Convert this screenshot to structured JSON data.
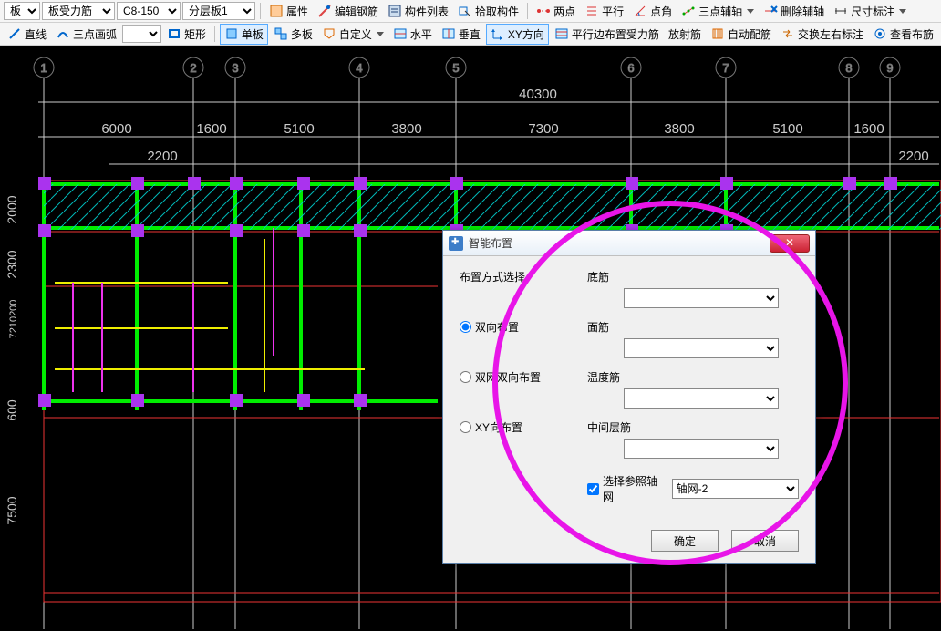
{
  "toolbar1": {
    "sel_layer": "板",
    "sel_rebar_type": "板受力筋",
    "sel_spec": "C8-150",
    "sel_group": "分层板1",
    "btn_props": "属性",
    "btn_edit_rebar": "编辑钢筋",
    "btn_elem_list": "构件列表",
    "btn_pick_elem": "拾取构件",
    "btn_two_pt": "两点",
    "btn_parallel": "平行",
    "btn_pt_angle": "点角",
    "btn_three_pt_aux": "三点辅轴",
    "btn_del_aux": "删除辅轴",
    "btn_dim": "尺寸标注"
  },
  "toolbar2": {
    "btn_line": "直线",
    "btn_arc3": "三点画弧",
    "color_box": "",
    "btn_rect": "矩形",
    "btn_single": "单板",
    "btn_multi": "多板",
    "btn_custom": "自定义",
    "btn_horiz": "水平",
    "btn_vert": "垂直",
    "btn_xy": "XY方向",
    "btn_par_edge": "平行边布置受力筋",
    "btn_radial": "放射筋",
    "btn_auto": "自动配筋",
    "btn_swap_lr": "交换左右标注",
    "btn_view_arr": "查看布筋"
  },
  "canvas_labels": {
    "top_total": "40300",
    "spans_top": [
      "6000",
      "1600",
      "5100",
      "3800",
      "7300",
      "3800",
      "5100",
      "1600"
    ],
    "sub1": "2200",
    "sub2": "2200",
    "left": [
      "2000",
      "2300",
      "7210200",
      "600",
      "7500"
    ],
    "grid_top": [
      "1",
      "2",
      "3",
      "4",
      "5",
      "6",
      "7",
      "8",
      "9"
    ]
  },
  "dialog": {
    "title": "智能布置",
    "section_title": "布置方式选择",
    "radio1": "双向布置",
    "radio2": "双网双向布置",
    "radio3": "XY向布置",
    "lbl_bottom": "底筋",
    "lbl_top": "面筋",
    "lbl_temp": "温度筋",
    "lbl_mid": "中间层筋",
    "chk_ref_axis": "选择参照轴网",
    "axis_val": "轴网-2",
    "btn_ok": "确定",
    "btn_cancel": "取消",
    "val_bottom": "",
    "val_top": "",
    "val_temp": "",
    "val_mid": ""
  }
}
